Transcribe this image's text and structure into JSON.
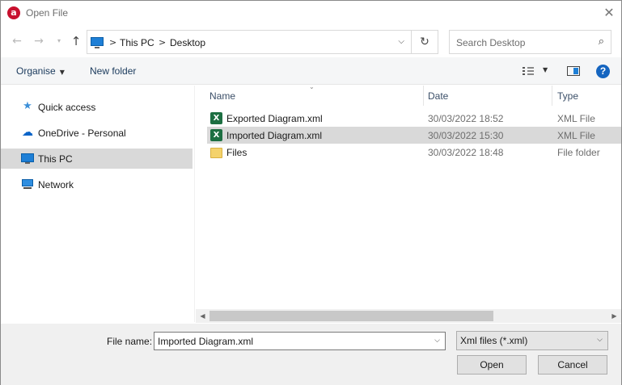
{
  "window": {
    "title": "Open File",
    "close_glyph": "✕",
    "app_icon_letter": "a"
  },
  "address": {
    "breadcrumbs": [
      "This PC",
      "Desktop"
    ],
    "separator": ">",
    "search_placeholder": "Search Desktop"
  },
  "toolbar": {
    "organise_label": "Organise",
    "new_folder_label": "New folder",
    "help_glyph": "?"
  },
  "nav_pane": {
    "items": [
      {
        "label": "Quick access",
        "icon": "quick-access-star-icon",
        "selected": false
      },
      {
        "label": "OneDrive - Personal",
        "icon": "onedrive-cloud-icon",
        "selected": false
      },
      {
        "label": "This PC",
        "icon": "this-pc-icon",
        "selected": true
      },
      {
        "label": "Network",
        "icon": "network-icon",
        "selected": false
      }
    ]
  },
  "file_list": {
    "columns": {
      "name": "Name",
      "date": "Date",
      "type": "Type"
    },
    "files": [
      {
        "name": "Exported Diagram.xml",
        "date": "30/03/2022 18:52",
        "type": "XML File",
        "icon": "excel-xml-file-icon",
        "selected": false
      },
      {
        "name": "Imported Diagram.xml",
        "date": "30/03/2022 15:30",
        "type": "XML File",
        "icon": "excel-xml-file-icon",
        "selected": true
      },
      {
        "name": "Files",
        "date": "30/03/2022 18:48",
        "type": "File folder",
        "icon": "folder-icon",
        "selected": false
      }
    ]
  },
  "bottom": {
    "file_name_label": "File name:",
    "file_name_value": "Imported Diagram.xml",
    "file_type_filter": "Xml files (*.xml)",
    "open_label": "Open",
    "cancel_label": "Cancel"
  },
  "colors": {
    "selection": "#d9d9d9",
    "accent_blue": "#1e7fd6",
    "excel_green": "#1d6f42",
    "folder_yellow": "#f4d26b"
  }
}
